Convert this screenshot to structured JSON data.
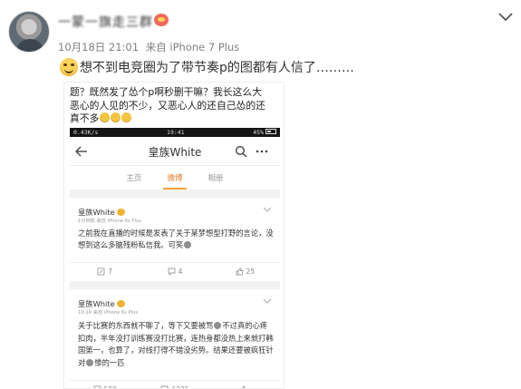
{
  "post": {
    "username": "一蒙一旗走三群",
    "timestamp": "10月18日 21:01",
    "source": "来自 iPhone 7 Plus",
    "text": "想不到电竞圈为了带节奏p的图都有人信了………"
  },
  "image": {
    "caption_line1": "题？既然发了怂个p啊秒删干嘛？我长这么大",
    "caption_line2": "恶心的人见的不少，又恶心人的还自己怂的还",
    "caption_line3": "真不多",
    "phone": {
      "status_left": "0.43K/s",
      "status_time": "19:41",
      "status_battery": "45%",
      "nav_title": "皇族White",
      "tabs": [
        "主页",
        "微博",
        "相册"
      ],
      "active_tab": 1
    },
    "card1": {
      "name": "皇族White",
      "meta": "1分钟前  来自 iPhone 6s Plus",
      "text": "之前我在直播的时候是发表了关于某梦想型打野的言论，没想到这么多脑残粉私信我。可笑",
      "reposts": "7",
      "comments": "4",
      "likes": "25"
    },
    "card2": {
      "name": "皇族White",
      "meta": "10-16  来自 iPhone 6s Plus",
      "text_a": "关于比赛的东西就不聊了，等下又要被骂",
      "text_b": "不过真的心疼扣肉，半年没打训练赛没打比赛，连热身都没热上来就打韩国第一，也算了，对线打得不错没劣势。结果还要被疯狂针对",
      "text_c": "惨的一匹",
      "reposts": "500",
      "comments": "1225",
      "likes": ""
    }
  },
  "colors": {
    "accent_orange": "#e37b26",
    "meta_gray": "#808080"
  }
}
